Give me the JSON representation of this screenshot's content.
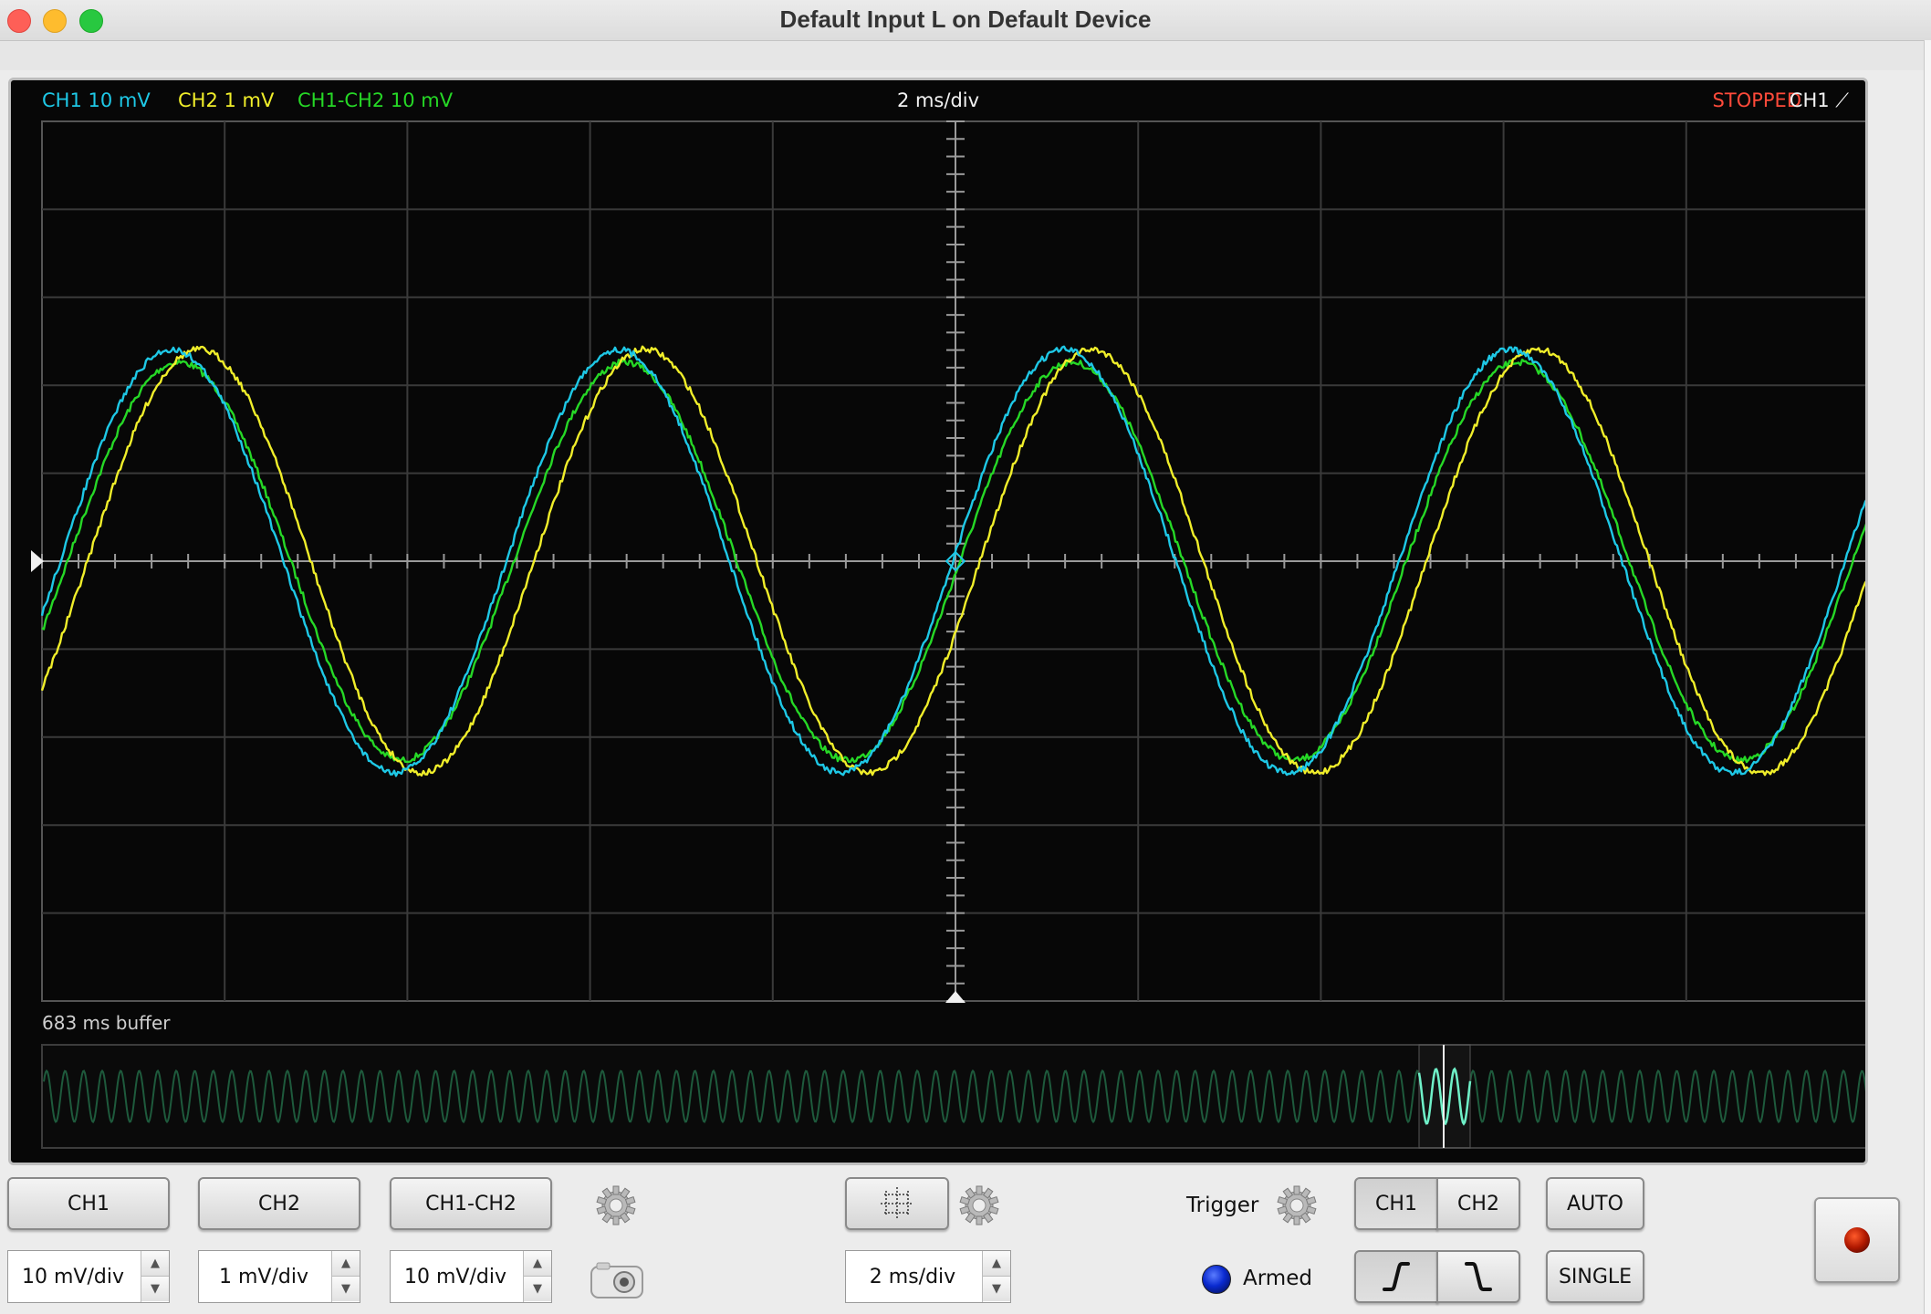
{
  "window": {
    "title": "Default Input L on Default Device"
  },
  "scope": {
    "ch1_label": "CH1 10 mV",
    "ch2_label": "CH2 1 mV",
    "diff_label": "CH1-CH2 10 mV",
    "timebase_label": "2 ms/div",
    "status": "STOPPED",
    "trigger_channel": "CH1",
    "trigger_slope_glyph": "⟋",
    "buffer_label": "683 ms buffer",
    "grid": {
      "h_divisions": 10,
      "v_divisions": 10
    }
  },
  "colors": {
    "ch1": "#1ec8e6",
    "ch2": "#f0ee2a",
    "diff": "#26d826",
    "status": "#ff4a3a",
    "grid": "#3a3a3a"
  },
  "controls": {
    "ch1_button": "CH1",
    "ch2_button": "CH2",
    "diff_button": "CH1-CH2",
    "ch1_scale": "10 mV/div",
    "ch2_scale": "1 mV/div",
    "diff_scale": "10 mV/div",
    "timebase_scale": "2 ms/div",
    "trigger_label": "Trigger",
    "trigger_ch1": "CH1",
    "trigger_ch2": "CH2",
    "auto_button": "AUTO",
    "single_button": "SINGLE",
    "armed_label": "Armed"
  }
}
